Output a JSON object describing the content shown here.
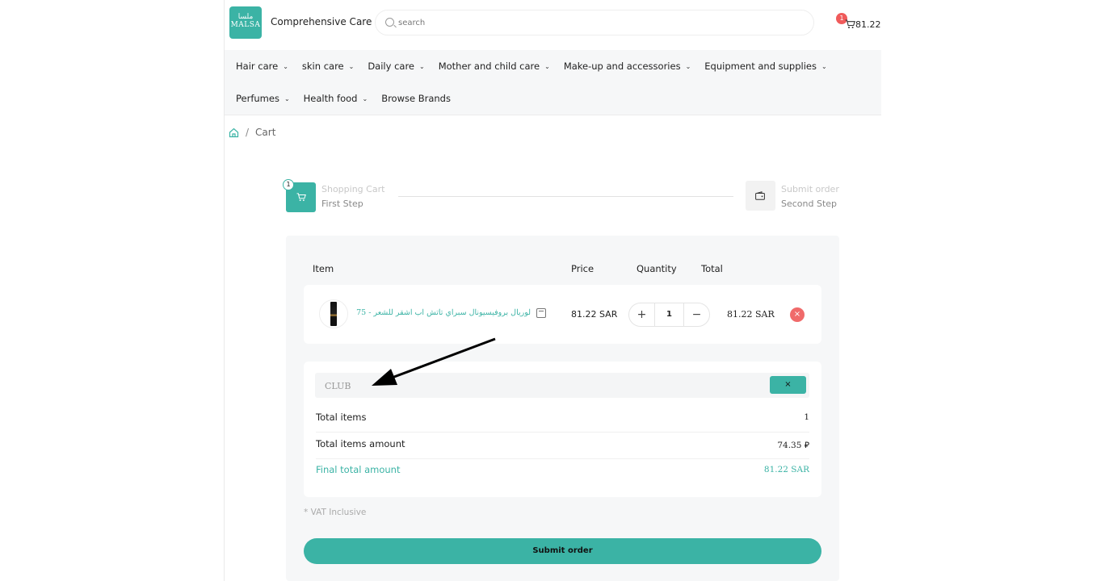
{
  "header": {
    "logo_text": "ملسا MALSA",
    "brand_name": "Comprehensive Care",
    "search": {
      "placeholder": "search",
      "value": ""
    },
    "cart": {
      "badge_count": "1",
      "total": "81.22 SAR"
    }
  },
  "nav": {
    "row1": [
      {
        "label": "Hair care",
        "has_dropdown": true
      },
      {
        "label": "skin care",
        "has_dropdown": true
      },
      {
        "label": "Daily care",
        "has_dropdown": true
      },
      {
        "label": "Mother and child care",
        "has_dropdown": true
      },
      {
        "label": "Make-up and accessories",
        "has_dropdown": true
      },
      {
        "label": "Equipment and supplies",
        "has_dropdown": true
      }
    ],
    "row2": [
      {
        "label": "Perfumes",
        "has_dropdown": true
      },
      {
        "label": "Health food",
        "has_dropdown": true
      },
      {
        "label": "Browse Brands",
        "has_dropdown": false
      }
    ],
    "chevron": "⌄"
  },
  "breadcrumb": {
    "separator": "/",
    "current": "Cart"
  },
  "steps": [
    {
      "number": "1",
      "title": "Shopping Cart",
      "subtitle": "First Step",
      "icon": "cart-icon",
      "active": true
    },
    {
      "title": "Submit order",
      "subtitle": "Second Step",
      "icon": "wallet-icon",
      "active": false
    }
  ],
  "cart_table": {
    "headers": {
      "item": "Item",
      "price": "Price",
      "quantity": "Quantity",
      "total": "Total"
    },
    "items": [
      {
        "name": "لوريال بروفيسيونال سبراي تاتش اب اشقر للشعر - 75 مل",
        "price": "81.22 SAR",
        "quantity": "1",
        "total": "81.22 SAR"
      }
    ],
    "qty_plus": "+",
    "qty_minus": "−",
    "remove": "×"
  },
  "coupon": {
    "value": "CLUB",
    "clear_label": "×"
  },
  "summary": {
    "total_items_label": "Total items",
    "total_items_value": "1",
    "items_amount_label": "Total items amount",
    "items_amount_value": "74.35 ⃁",
    "final_label": "Final total amount",
    "final_value": "81.22 SAR"
  },
  "vat_note": "* VAT Inclusive",
  "submit_label": "Submit order",
  "colors": {
    "accent": "#3bb3a5",
    "danger": "#f06a6a",
    "panel": "#f6f7f8"
  }
}
